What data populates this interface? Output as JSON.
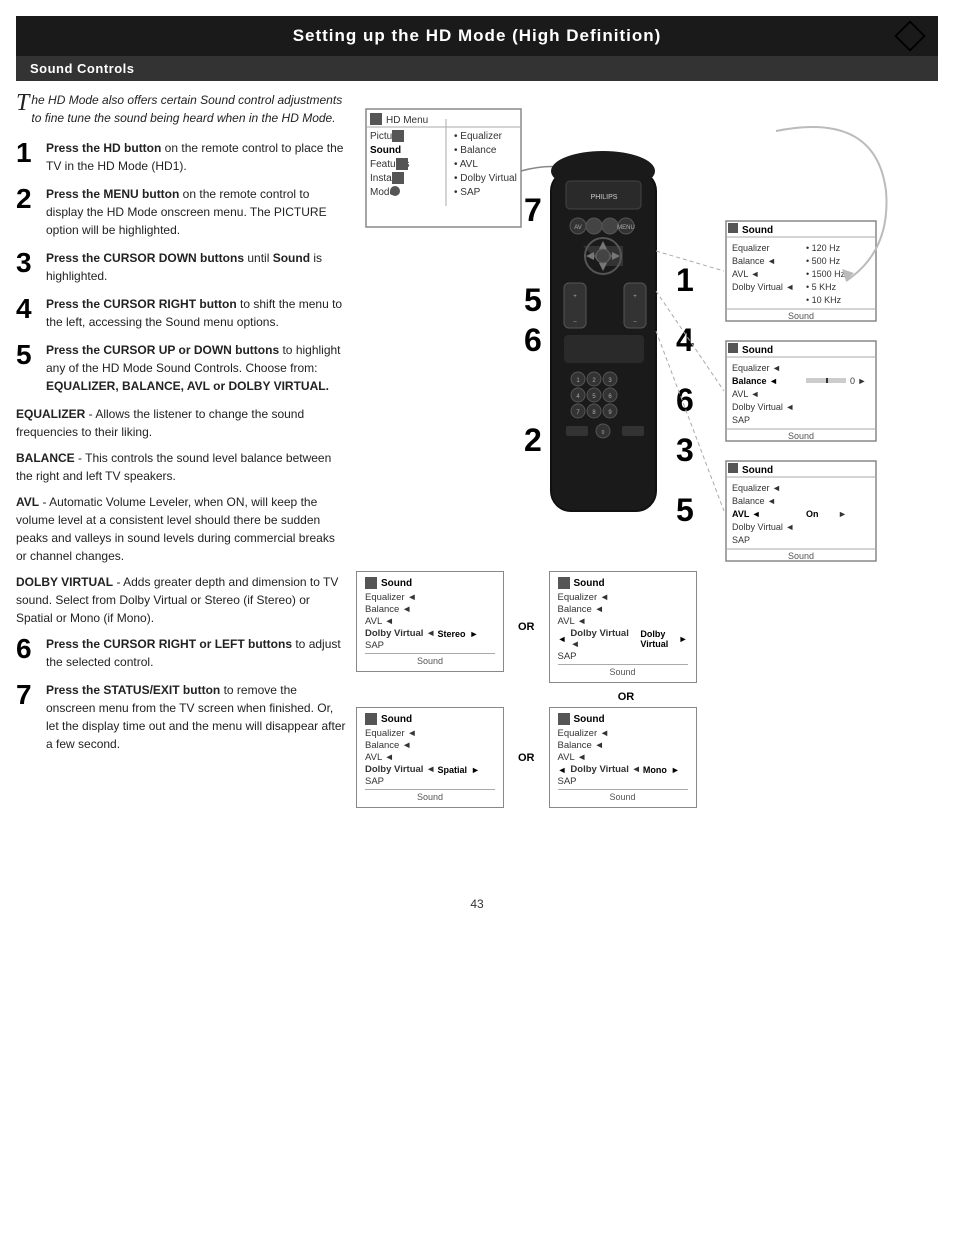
{
  "page": {
    "title": "Setting up the HD Mode (High Definition)",
    "section": "Sound Controls",
    "page_number": "43"
  },
  "intro": {
    "text": "he HD Mode also offers certain Sound control adjustments to fine tune the sound being heard when in the HD Mode."
  },
  "steps": [
    {
      "num": "1",
      "text": "Press the HD button on the remote control to place the TV in the HD Mode (HD1)."
    },
    {
      "num": "2",
      "text": "Press the MENU button on the remote control to display the HD Mode onscreen menu. The PICTURE option will be highlighted."
    },
    {
      "num": "3",
      "text": "Press the CURSOR DOWN buttons until Sound is highlighted."
    },
    {
      "num": "4",
      "text": "Press the CURSOR RIGHT button to shift the menu to the left, accessing the Sound menu options."
    },
    {
      "num": "5",
      "text": "Press the CURSOR UP or DOWN buttons to highlight any of the HD Mode Sound Controls. Choose from: EQUALIZER, BALANCE, AVL or DOLBY VIRTUAL."
    }
  ],
  "terms": [
    {
      "term": "EQUALIZER",
      "definition": "- Allows the listener to change the sound frequencies to their liking."
    },
    {
      "term": "BALANCE",
      "definition": "- This controls the sound level balance between the right and left TV speakers."
    },
    {
      "term": "AVL",
      "definition": "- Automatic Volume Leveler, when ON, will keep the volume level at a consistent level should there be sudden peaks and valleys in sound levels during commercial breaks or channel changes."
    },
    {
      "term": "DOLBY VIRTUAL",
      "definition": "- Adds greater depth and dimension to TV sound. Select from Dolby Virtual or Stereo (if Stereo) or Spatial or Mono (if Mono)."
    }
  ],
  "steps_6_7": [
    {
      "num": "6",
      "text": "Press the CURSOR RIGHT or LEFT buttons to adjust the selected control."
    },
    {
      "num": "7",
      "text": "Press the STATUS/EXIT button to remove the onscreen menu from the TV screen when finished. Or, let the display time out and the menu will disappear after a few second."
    }
  ],
  "hd_menu": {
    "title": "HD Menu",
    "rows": [
      {
        "label": "Picture",
        "option": ""
      },
      {
        "label": "Sound",
        "option": ""
      },
      {
        "label": "Features",
        "option": ""
      },
      {
        "label": "Install",
        "option": ""
      },
      {
        "label": "Mode",
        "option": ""
      }
    ],
    "options": [
      "Equalizer",
      "Balance",
      "AVL",
      "Dolby Virtual",
      "SAP"
    ]
  },
  "sound_panels": {
    "panel1": {
      "title": "Sound",
      "rows": [
        {
          "label": "Equalizer",
          "value": "120 Hz",
          "type": "bullet"
        },
        {
          "label": "Balance",
          "value": "500 Hz",
          "type": "bullet"
        },
        {
          "label": "AVL",
          "value": "1500 Hz",
          "type": "bullet"
        },
        {
          "label": "Dolby Virtual",
          "value": "5 KHz",
          "type": "bullet"
        },
        {
          "label": "",
          "value": "10 KHz",
          "type": "bullet"
        },
        {
          "label": "Sound",
          "value": "",
          "type": "footer"
        }
      ]
    },
    "panel2": {
      "title": "Sound",
      "rows": [
        {
          "label": "Equalizer",
          "type": "arrow"
        },
        {
          "label": "Balance",
          "type": "slider",
          "val": "0"
        },
        {
          "label": "AVL",
          "type": "arrow"
        },
        {
          "label": "Dolby Virtual",
          "type": "arrow"
        },
        {
          "label": "SAP",
          "type": "plain"
        },
        {
          "label": "Sound",
          "type": "footer"
        }
      ]
    },
    "panel3": {
      "title": "Sound",
      "rows": [
        {
          "label": "Equalizer",
          "type": "arrow"
        },
        {
          "label": "Balance",
          "type": "arrow"
        },
        {
          "label": "AVL",
          "type": "slider_on",
          "val": "On"
        },
        {
          "label": "Dolby Virtual",
          "type": "arrow"
        },
        {
          "label": "SAP",
          "type": "plain"
        },
        {
          "label": "Sound",
          "type": "footer"
        }
      ]
    },
    "panel4": {
      "title": "Sound",
      "rows": [
        {
          "label": "Equalizer",
          "type": "arrow"
        },
        {
          "label": "Balance",
          "type": "arrow"
        },
        {
          "label": "AVL",
          "type": "arrow"
        },
        {
          "label": "Dolby Virtual",
          "type": "slider_stereo",
          "val": "Stereo"
        },
        {
          "label": "SAP",
          "type": "plain"
        },
        {
          "label": "Sound",
          "type": "footer"
        }
      ]
    },
    "panel5": {
      "title": "Sound",
      "rows": [
        {
          "label": "Equalizer",
          "type": "arrow"
        },
        {
          "label": "Balance",
          "type": "arrow"
        },
        {
          "label": "AVL",
          "type": "arrow"
        },
        {
          "label": "Dolby Virtual",
          "type": "slider_dv",
          "val": "Dolby Virtual"
        },
        {
          "label": "SAP",
          "type": "plain"
        },
        {
          "label": "Sound",
          "type": "footer"
        }
      ]
    },
    "panel6": {
      "title": "Sound",
      "rows": [
        {
          "label": "Equalizer",
          "type": "arrow"
        },
        {
          "label": "Balance",
          "type": "arrow"
        },
        {
          "label": "AVL",
          "type": "arrow"
        },
        {
          "label": "Dolby Virtual",
          "type": "slider_spatial",
          "val": "Spatial"
        },
        {
          "label": "SAP",
          "type": "plain"
        },
        {
          "label": "Sound",
          "type": "footer"
        }
      ]
    },
    "panel7": {
      "title": "Sound",
      "rows": [
        {
          "label": "Equalizer",
          "type": "arrow"
        },
        {
          "label": "Balance",
          "type": "arrow"
        },
        {
          "label": "AVL",
          "type": "arrow"
        },
        {
          "label": "Dolby Virtual",
          "type": "slider_mono",
          "val": "Mono"
        },
        {
          "label": "SAP",
          "type": "plain"
        },
        {
          "label": "Sound",
          "type": "footer"
        }
      ]
    }
  },
  "labels": {
    "or": "OR"
  }
}
